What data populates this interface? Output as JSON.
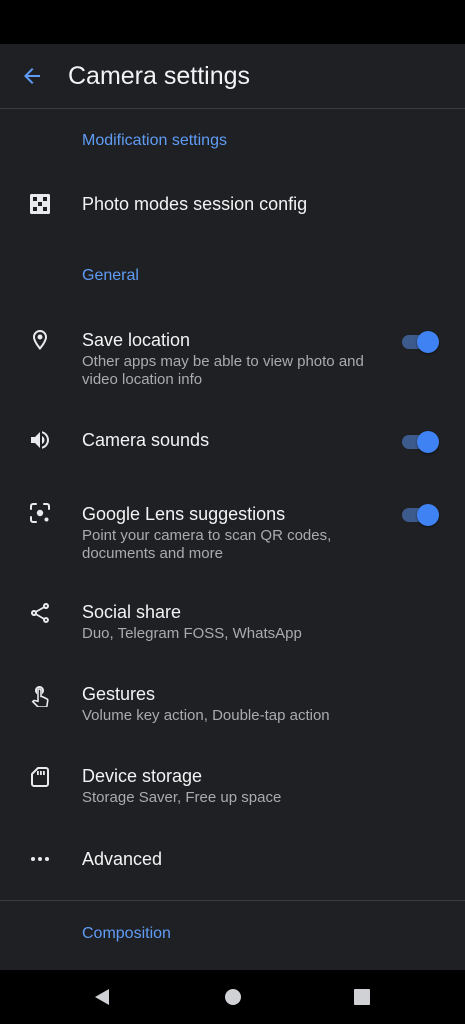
{
  "header": {
    "title": "Camera settings",
    "back_icon": "arrow-back-icon"
  },
  "sections": {
    "modification": "Modification settings",
    "general": "General",
    "composition": "Composition"
  },
  "items": {
    "photo_modes": {
      "title": "Photo modes session config",
      "icon": "settings-grid-icon"
    },
    "save_location": {
      "title": "Save location",
      "subtitle": "Other apps may be able to view photo and video location info",
      "icon": "location-pin-icon",
      "toggle_on": true
    },
    "camera_sounds": {
      "title": "Camera sounds",
      "icon": "volume-icon",
      "toggle_on": true
    },
    "lens": {
      "title": "Google Lens suggestions",
      "subtitle": "Point your camera to scan QR codes, documents and more",
      "icon": "lens-icon",
      "toggle_on": true
    },
    "social_share": {
      "title": "Social share",
      "subtitle": "Duo, Telegram FOSS, WhatsApp",
      "icon": "share-icon"
    },
    "gestures": {
      "title": "Gestures",
      "subtitle": "Volume key action, Double-tap action",
      "icon": "gesture-icon"
    },
    "storage": {
      "title": "Device storage",
      "subtitle": "Storage Saver, Free up space",
      "icon": "sd-card-icon"
    },
    "advanced": {
      "title": "Advanced",
      "icon": "more-horiz-icon"
    }
  },
  "navbar": {
    "back_icon": "nav-back-icon",
    "home_icon": "nav-home-icon",
    "recents_icon": "nav-recents-icon"
  },
  "colors": {
    "background": "#1f2023",
    "accent": "#5f9cf5",
    "toggle_thumb": "#3f82f4",
    "toggle_track": "#3d5a8c",
    "text_primary": "#f1f3f4",
    "text_secondary": "#a8abb0"
  }
}
